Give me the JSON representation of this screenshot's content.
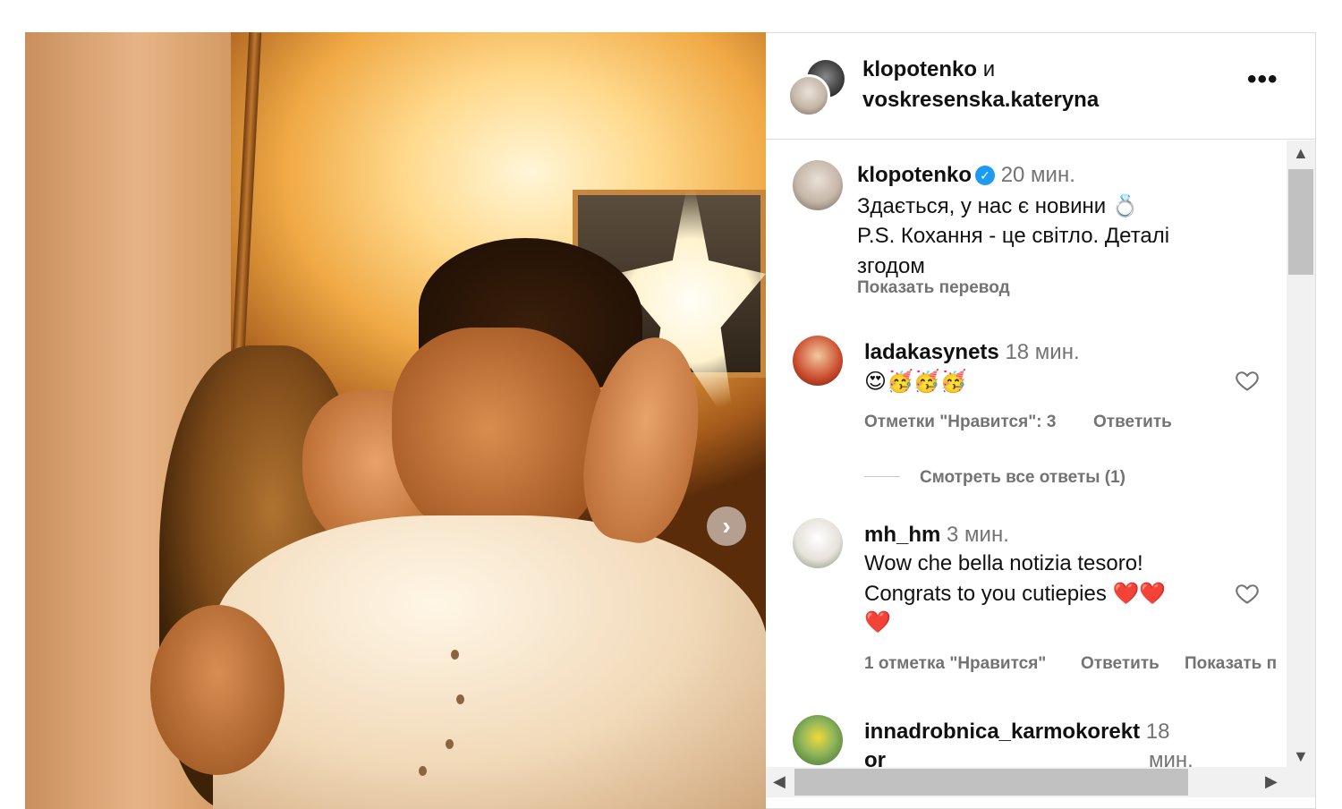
{
  "post": {
    "header": {
      "user1": "klopotenko",
      "connector": "и",
      "user2": "voskresenska.kateryna",
      "more_icon": "more-horizontal-icon"
    },
    "caption": {
      "username": "klopotenko",
      "time": "20 мин.",
      "line1": "Здається, у нас є новини 💍",
      "line2": "P.S. Кохання - це світло. Деталі",
      "line3": "згодом",
      "translate": "Показать перевод"
    },
    "comments": [
      {
        "username": "ladakasynets",
        "time": "18 мин.",
        "text": "😍🥳🥳🥳",
        "likes": "Отметки \"Нравится\": 3",
        "reply": "Ответить",
        "view_replies": "Смотреть все ответы (1)"
      },
      {
        "username": "mh_hm",
        "time": "3 мин.",
        "line1": "Wow che bella notizia tesoro!",
        "line2": "Congrats to you cutiepies ❤️❤️",
        "line3": "❤️",
        "likes": "1 отметка \"Нравится\"",
        "reply": "Ответить",
        "translate": "Показать п"
      },
      {
        "username": "innadrobnica_karmokorekt",
        "username_tail": "or",
        "time_num": "18",
        "time_unit": "мин."
      }
    ]
  },
  "colors": {
    "text": "#111111",
    "muted": "#737373",
    "border": "#dbdbdb",
    "verified": "#1d9bf0"
  }
}
